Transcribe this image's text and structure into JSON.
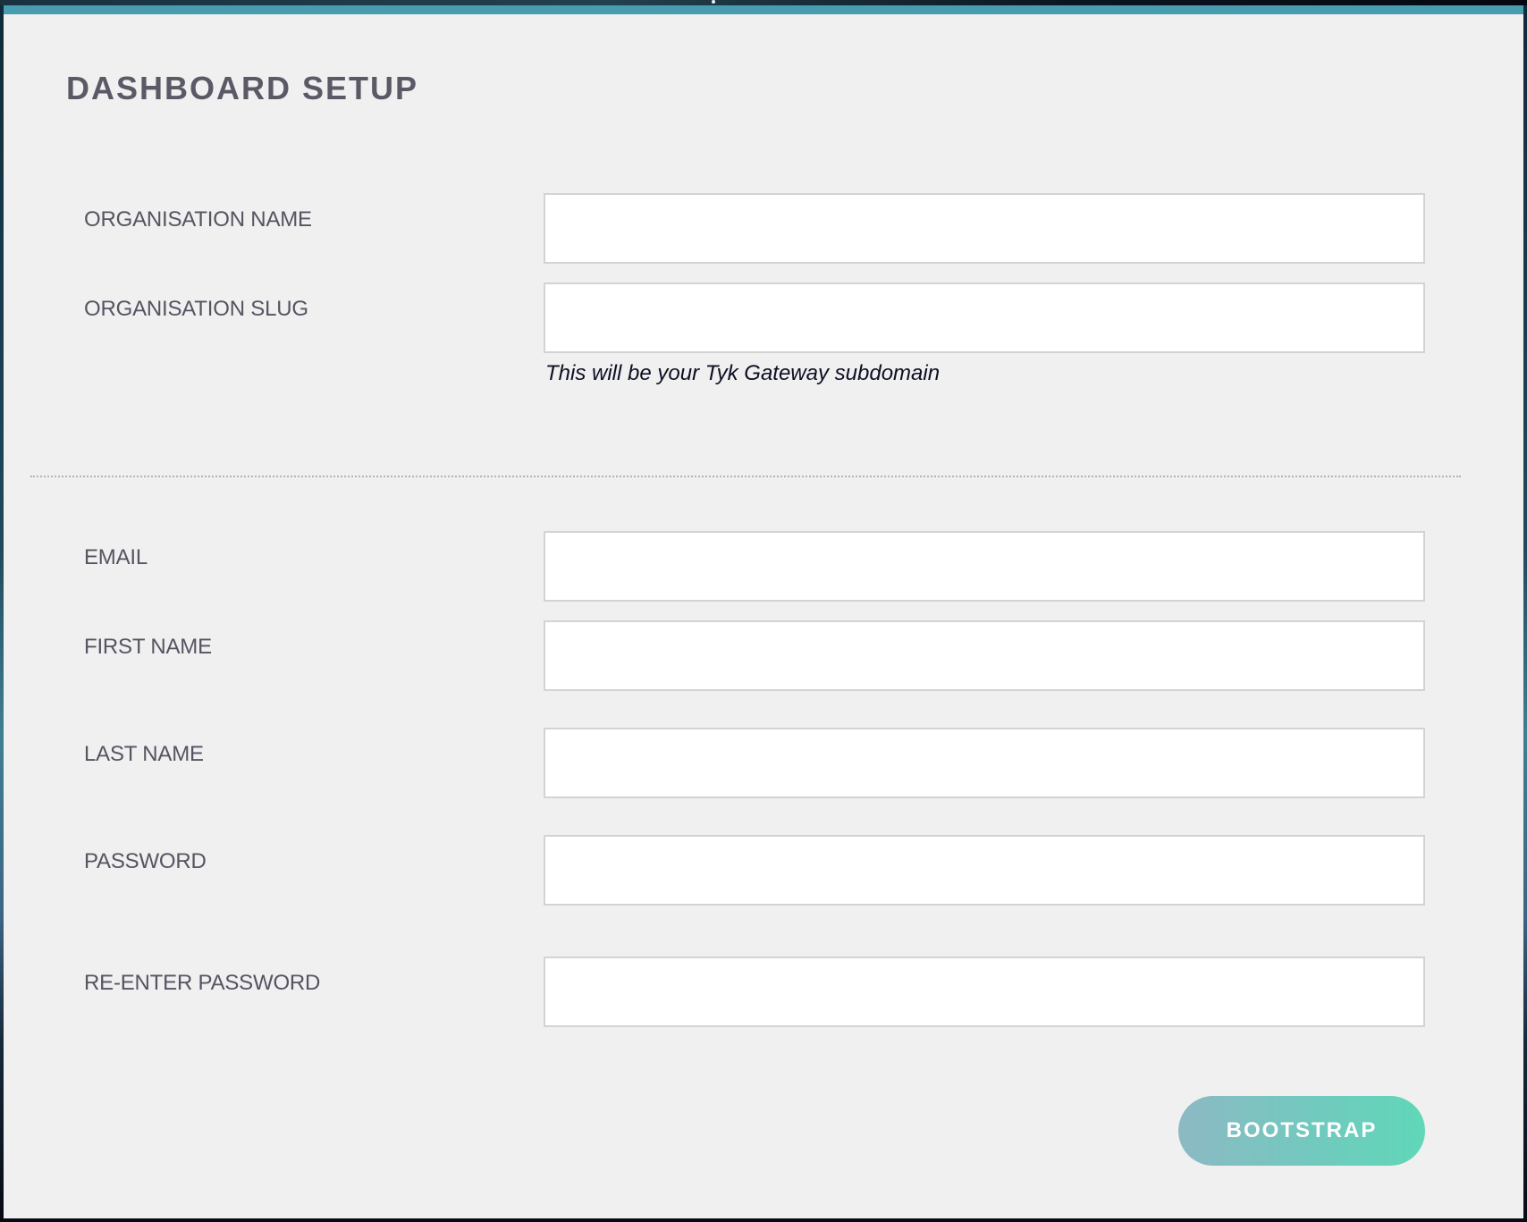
{
  "page": {
    "title": "DASHBOARD SETUP"
  },
  "colors": {
    "accent_bar": "#479daf",
    "panel_background": "#f0f0f0",
    "label_text": "#555461",
    "button_gradient_start": "#8cb9c3",
    "button_gradient_end": "#60d7b8"
  },
  "organisation": {
    "name": {
      "label": "ORGANISATION NAME",
      "value": "",
      "placeholder": ""
    },
    "slug": {
      "label": "ORGANISATION SLUG",
      "value": "",
      "placeholder": "",
      "helper": "This will be your Tyk Gateway subdomain"
    }
  },
  "user": {
    "email": {
      "label": "EMAIL",
      "value": "",
      "placeholder": ""
    },
    "first_name": {
      "label": "FIRST NAME",
      "value": "",
      "placeholder": ""
    },
    "last_name": {
      "label": "LAST NAME",
      "value": "",
      "placeholder": ""
    },
    "password": {
      "label": "PASSWORD",
      "value": "",
      "placeholder": ""
    },
    "confirm_password": {
      "label": "RE-ENTER PASSWORD",
      "value": "",
      "placeholder": ""
    }
  },
  "actions": {
    "submit_label": "BOOTSTRAP"
  }
}
